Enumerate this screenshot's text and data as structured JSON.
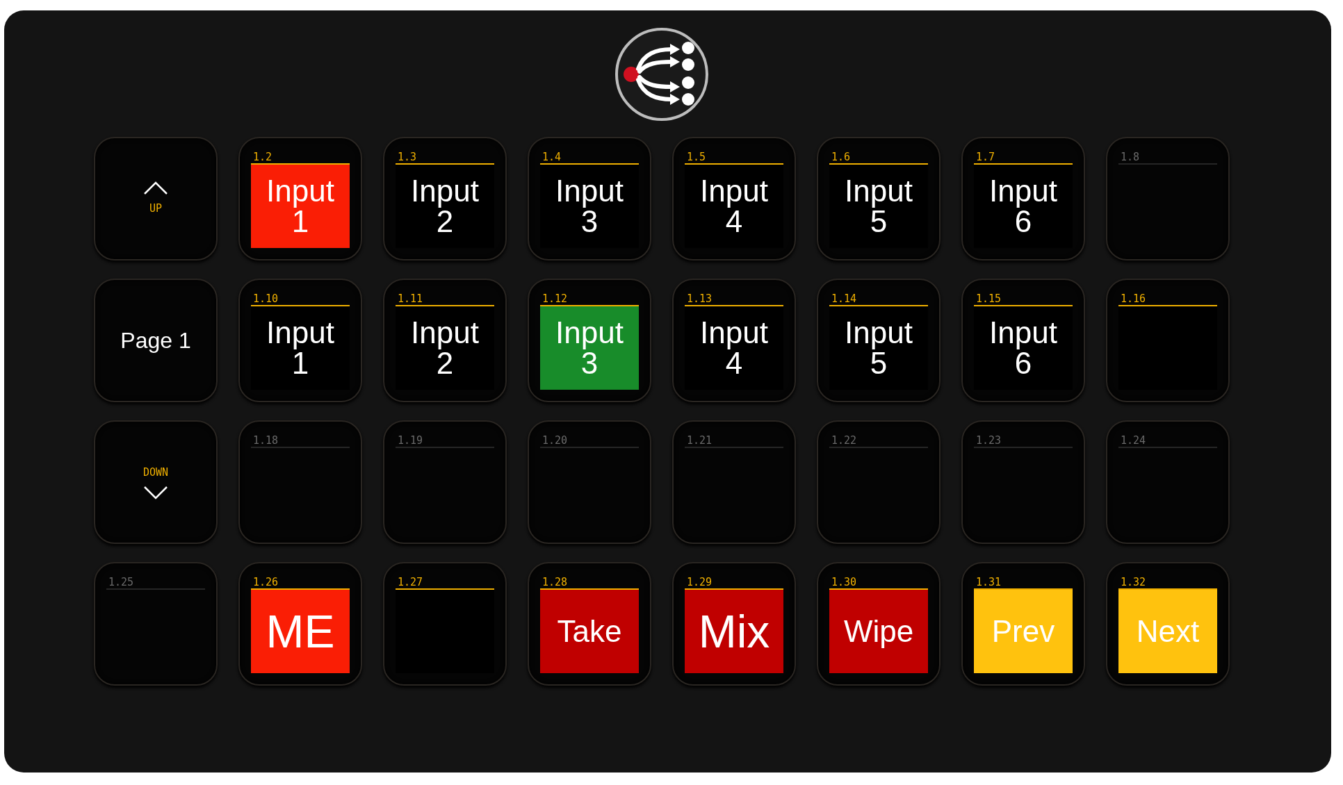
{
  "rows": [
    {
      "keys": [
        {
          "kind": "nav-up",
          "label": "UP"
        },
        {
          "kind": "button",
          "number": "1.2",
          "label": "Input 1",
          "color": "#fa1e05"
        },
        {
          "kind": "button",
          "number": "1.3",
          "label": "Input 2",
          "color": "#000000"
        },
        {
          "kind": "button",
          "number": "1.4",
          "label": "Input 3",
          "color": "#000000"
        },
        {
          "kind": "button",
          "number": "1.5",
          "label": "Input 4",
          "color": "#000000"
        },
        {
          "kind": "button",
          "number": "1.6",
          "label": "Input 5",
          "color": "#000000"
        },
        {
          "kind": "button",
          "number": "1.7",
          "label": "Input 6",
          "color": "#000000"
        },
        {
          "kind": "blank",
          "number": "1.8"
        }
      ]
    },
    {
      "keys": [
        {
          "kind": "page",
          "label": "Page 1"
        },
        {
          "kind": "button",
          "number": "1.10",
          "label": "Input 1",
          "color": "#000000"
        },
        {
          "kind": "button",
          "number": "1.11",
          "label": "Input 2",
          "color": "#000000"
        },
        {
          "kind": "button",
          "number": "1.12",
          "label": "Input 3",
          "color": "#188c2a"
        },
        {
          "kind": "button",
          "number": "1.13",
          "label": "Input 4",
          "color": "#000000"
        },
        {
          "kind": "button",
          "number": "1.14",
          "label": "Input 5",
          "color": "#000000"
        },
        {
          "kind": "button",
          "number": "1.15",
          "label": "Input 6",
          "color": "#000000"
        },
        {
          "kind": "button",
          "number": "1.16",
          "color": "#000000"
        }
      ]
    },
    {
      "keys": [
        {
          "kind": "nav-down",
          "label": "DOWN"
        },
        {
          "kind": "blank",
          "number": "1.18"
        },
        {
          "kind": "blank",
          "number": "1.19"
        },
        {
          "kind": "blank",
          "number": "1.20"
        },
        {
          "kind": "blank",
          "number": "1.21"
        },
        {
          "kind": "blank",
          "number": "1.22"
        },
        {
          "kind": "blank",
          "number": "1.23"
        },
        {
          "kind": "blank",
          "number": "1.24"
        }
      ]
    },
    {
      "keys": [
        {
          "kind": "blank",
          "number": "1.25"
        },
        {
          "kind": "button",
          "number": "1.26",
          "label": "ME",
          "color": "#fa1e05"
        },
        {
          "kind": "button",
          "number": "1.27",
          "color": "#000000"
        },
        {
          "kind": "button",
          "number": "1.28",
          "label": "Take",
          "color": "#c00000"
        },
        {
          "kind": "button",
          "number": "1.29",
          "label": "Mix",
          "color": "#c00000"
        },
        {
          "kind": "button",
          "number": "1.30",
          "label": "Wipe",
          "color": "#c00000"
        },
        {
          "kind": "button",
          "number": "1.31",
          "label": "Prev",
          "color": "#ffc20e"
        },
        {
          "kind": "button",
          "number": "1.32",
          "label": "Next",
          "color": "#ffc20e"
        }
      ]
    }
  ]
}
